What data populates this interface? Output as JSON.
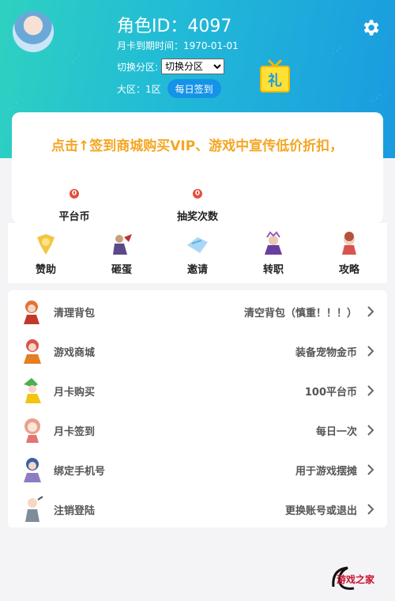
{
  "profile": {
    "role_id": "角色ID：4097",
    "card_expire": "月卡到期时间：1970-01-01",
    "zone_label": "切换分区:",
    "zone_selected": "切换分区",
    "region": "大区：1区",
    "checkin_button": "每日签到",
    "gift_char": "礼"
  },
  "marquee": "点击↑签到商城购买VIP、游戏中宣传低价折扣，",
  "stats": [
    {
      "value": "0",
      "label": "平台币"
    },
    {
      "value": "0",
      "label": "抽奖次数"
    }
  ],
  "quick_actions": [
    {
      "label": "赞助"
    },
    {
      "label": "砸蛋"
    },
    {
      "label": "邀请"
    },
    {
      "label": "转职"
    },
    {
      "label": "攻略"
    }
  ],
  "menu": [
    {
      "title": "清理背包",
      "desc": "清空背包（慎重！！！）"
    },
    {
      "title": "游戏商城",
      "desc": "装备宠物金币"
    },
    {
      "title": "月卡购买",
      "desc": "100平台币"
    },
    {
      "title": "月卡签到",
      "desc": "每日一次"
    },
    {
      "title": "绑定手机号",
      "desc": "用于游戏摆摊"
    },
    {
      "title": "注销登陆",
      "desc": "更换账号或退出"
    }
  ],
  "logo_text": "游戏之家",
  "colors": {
    "header_start": "#2fd1c0",
    "header_end": "#1a9be0",
    "accent": "#1593e8",
    "marquee": "#f5a623",
    "badge": "#e74c3c"
  }
}
